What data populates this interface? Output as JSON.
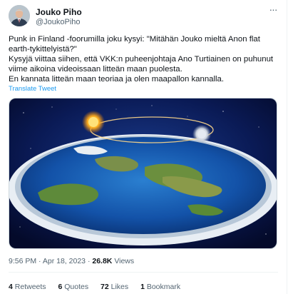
{
  "author": {
    "name": "Jouko Piho",
    "handle": "@JoukoPiho"
  },
  "more_icon": "ellipsis-icon",
  "tweet": {
    "lines": [
      "Punk in Finland -foorumilla joku kysyi: \"Mitähän Jouko mieltä Anon flat earth-tykittelyistä?\"",
      "Kysyjä viittaa siihen, että VKK:n puheenjohtaja Ano Turtiainen on puhunut viime aikoina videoissaan litteän maan puolesta.",
      "En kannata litteän maan teoriaa ja olen maapallon kannalla."
    ],
    "translate_label": "Translate Tweet"
  },
  "meta": {
    "time": "9:56 PM",
    "date": "Apr 18, 2023",
    "views_count": "26.8K",
    "views_label": "Views"
  },
  "stats": {
    "retweets_count": "4",
    "retweets_label": "Retweets",
    "quotes_count": "6",
    "quotes_label": "Quotes",
    "likes_count": "72",
    "likes_label": "Likes",
    "bookmarks_count": "1",
    "bookmarks_label": "Bookmark"
  },
  "colors": {
    "link": "#1d9bf0",
    "secondary_text": "#536471"
  }
}
